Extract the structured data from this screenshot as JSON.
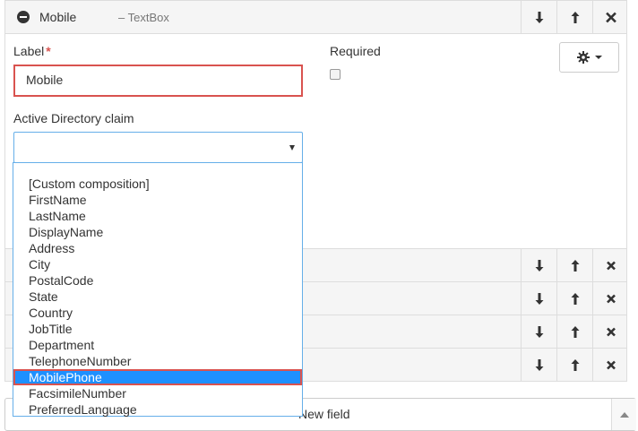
{
  "field": {
    "name": "Mobile",
    "type_label": "– TextBox"
  },
  "form": {
    "label_caption": "Label",
    "required_marker": "*",
    "label_value": "Mobile",
    "required_caption": "Required",
    "required_checked": false,
    "ad_claim_caption": "Active Directory claim",
    "ad_claim_value": ""
  },
  "dropdown": {
    "options": [
      "[Custom composition]",
      "FirstName",
      "LastName",
      "DisplayName",
      "Address",
      "City",
      "PostalCode",
      "State",
      "Country",
      "JobTitle",
      "Department",
      "TelephoneNumber",
      "MobilePhone",
      "FacsimileNumber",
      "PreferredLanguage"
    ],
    "selected": "MobilePhone"
  },
  "footer": {
    "add_field_visible_text": "New field"
  },
  "icons": {
    "collapse": "minus-circle-icon",
    "move_down": "arrow-down-icon",
    "move_up": "arrow-up-icon",
    "remove": "close-icon",
    "settings": "gear-icon",
    "dropdown": "caret-down-icon",
    "scroll_up": "chevron-up-icon"
  },
  "colors": {
    "highlight_border": "#d9534f",
    "selection_bg": "#1e90ff",
    "focus_border": "#66afe9"
  }
}
